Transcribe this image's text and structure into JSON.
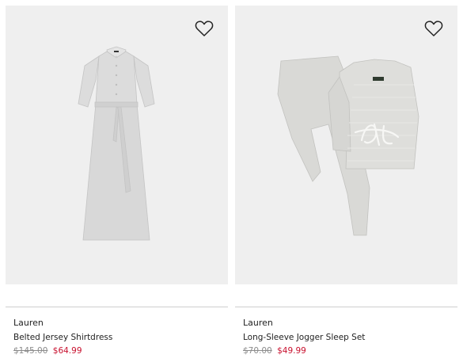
{
  "products": [
    {
      "brand": "Lauren",
      "name": "Belted Jersey Shirtdress",
      "original_price": "$145.00",
      "sale_price": "$64.99",
      "icon": "heart-icon"
    },
    {
      "brand": "Lauren",
      "name": "Long-Sleeve Jogger Sleep Set",
      "original_price": "$70.00",
      "sale_price": "$49.99",
      "icon": "heart-icon"
    }
  ],
  "colors": {
    "image_bg": "#efefef",
    "sale": "#c8102e",
    "strike": "#8c8c8c"
  }
}
